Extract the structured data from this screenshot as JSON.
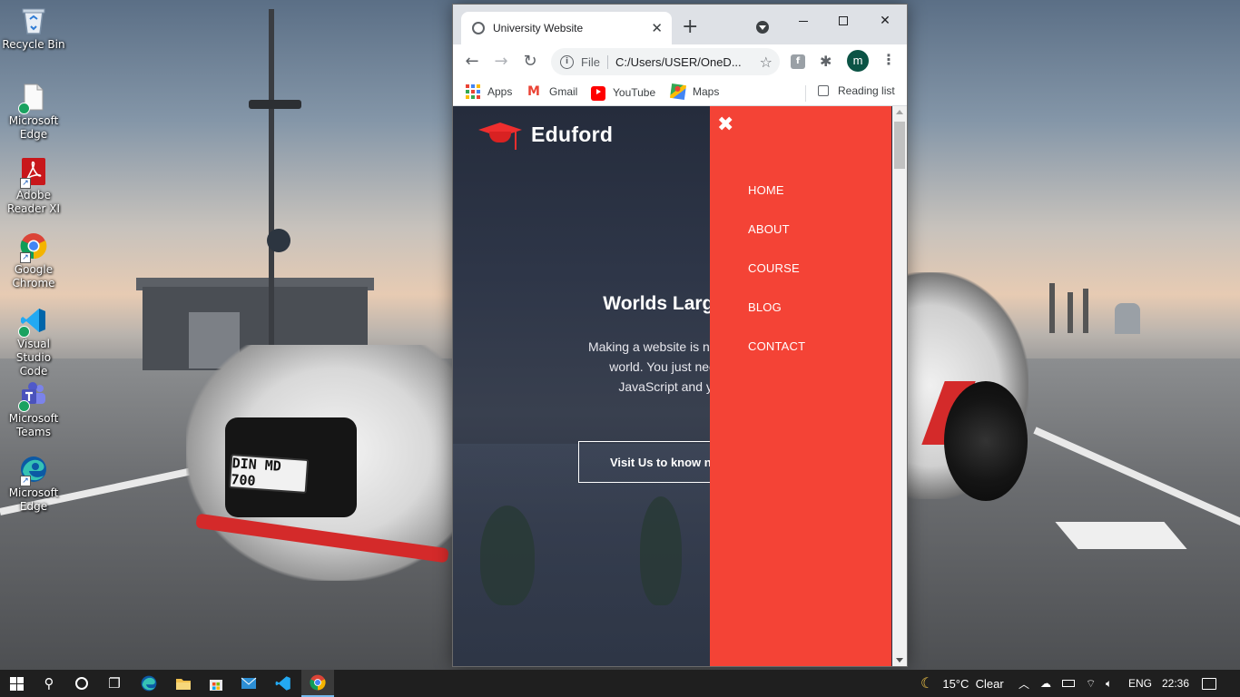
{
  "desktop": {
    "icons": [
      {
        "label": "Recycle Bin",
        "icon": "recycle-bin-icon"
      },
      {
        "label": "Microsoft\nEdge",
        "icon": "edge-file-icon"
      },
      {
        "label": "Adobe\nReader XI",
        "icon": "adobe-reader-icon"
      },
      {
        "label": "Google\nChrome",
        "icon": "chrome-icon"
      },
      {
        "label": "Visual Studio\nCode",
        "icon": "vscode-icon"
      },
      {
        "label": "Microsoft\nTeams",
        "icon": "teams-icon"
      },
      {
        "label": "Microsoft\nEdge",
        "icon": "edge-icon"
      }
    ],
    "wallpaper_plate": "DIN MD 700"
  },
  "browser": {
    "tab_title": "University Website",
    "new_tab": "+",
    "url_scheme": "File",
    "url": "C:/Users/USER/OneD...",
    "profile_initial": "m",
    "bookmarks": {
      "apps": "Apps",
      "gmail": "Gmail",
      "youtube": "YouTube",
      "maps": "Maps",
      "reading_list": "Reading list"
    }
  },
  "page": {
    "brand": "Eduford",
    "hero_title": "Worlds Largest U",
    "hero_text_line1": "Making a website is now one of th",
    "hero_text_line2": "world. You just need to lea",
    "hero_text_line3": "JavaScript and you are",
    "hero_button": "Visit Us to know n",
    "menu_close": "✖",
    "menu": [
      "HOME",
      "ABOUT",
      "COURSE",
      "BLOG",
      "CONTACT"
    ],
    "accent_color": "#f44336"
  },
  "taskbar": {
    "weather": "15°C  Clear",
    "language": "ENG",
    "time": "22:36"
  }
}
